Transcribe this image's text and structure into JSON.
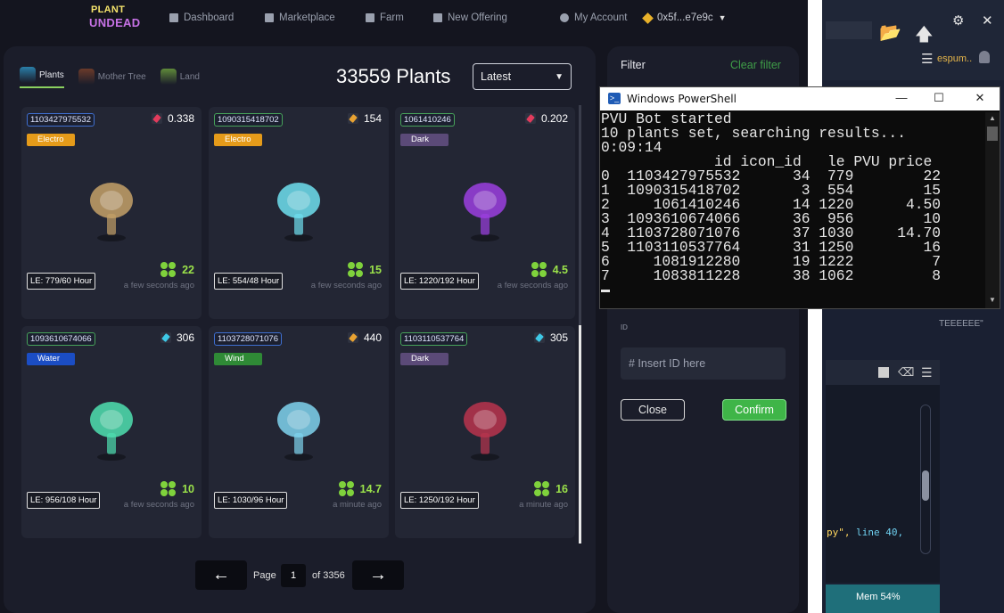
{
  "nav": {
    "logo_line1": "PLANT",
    "logo_line2": "UNDEAD",
    "items": [
      "Dashboard",
      "Marketplace",
      "Farm",
      "New Offering"
    ],
    "account": "My Account",
    "wallet": "0x5f...e7e9c"
  },
  "market": {
    "tabs": [
      "Plants",
      "Mother Tree",
      "Land"
    ],
    "count": "33559 Plants",
    "sort": "Latest",
    "cards": [
      {
        "id": "1103427975532",
        "price": "0.338",
        "price_icon": "red",
        "element": "Electro",
        "luck": "22",
        "le": "LE: 779/60 Hour",
        "ago": "a few seconds ago",
        "plant_color": "#c4a168"
      },
      {
        "id": "1090315418702",
        "price": "154",
        "price_icon": "orange",
        "element": "Electro",
        "luck": "15",
        "le": "LE: 554/48 Hour",
        "ago": "a few seconds ago",
        "plant_color": "#6fe0f0"
      },
      {
        "id": "1061410246",
        "price": "0.202",
        "price_icon": "red",
        "element": "Dark",
        "luck": "4.5",
        "le": "LE: 1220/192 Hour",
        "ago": "a few seconds ago",
        "plant_color": "#9b3fe0"
      },
      {
        "id": "1093610674066",
        "price": "306",
        "price_icon": "blue",
        "element": "Water",
        "luck": "10",
        "le": "LE: 956/108 Hour",
        "ago": "a few seconds ago",
        "plant_color": "#4fe0b0"
      },
      {
        "id": "1103728071076",
        "price": "440",
        "price_icon": "orange",
        "element": "Wind",
        "luck": "14.7",
        "le": "LE: 1030/96 Hour",
        "ago": "a minute ago",
        "plant_color": "#7fd4ee"
      },
      {
        "id": "1103110537764",
        "price": "305",
        "price_icon": "blue",
        "element": "Dark",
        "luck": "16",
        "le": "LE: 1250/192 Hour",
        "ago": "a minute ago",
        "plant_color": "#b8344e"
      }
    ],
    "pagination": {
      "page_label": "Page",
      "current": "1",
      "of_label": "of 3356"
    }
  },
  "filter": {
    "title": "Filter",
    "clear": "Clear filter",
    "id_label": "ID",
    "id_placeholder": "# Insert ID here",
    "close": "Close",
    "confirm": "Confirm"
  },
  "powershell": {
    "title": "Windows PowerShell",
    "lines": [
      "PVU Bot started",
      "10 plants set, searching results...",
      "0:09:14",
      "             id icon_id   le PVU price",
      "0  1103427975532      34  779        22",
      "1  1090315418702       3  554        15",
      "2     1061410246      14 1220      4.50",
      "3  1093610674066      36  956        10",
      "4  1103728071076      37 1030     14.70",
      "5  1103110537764      31 1250        16",
      "6     1081912280      19 1222         7",
      "7     1083811228      38 1062         8"
    ]
  },
  "background_app": {
    "partial_text": "espum..",
    "partial_quote": "TEEEEEE\"",
    "code_string": "py\",",
    "code_line": "line 40,",
    "mem": "Mem 54%"
  }
}
